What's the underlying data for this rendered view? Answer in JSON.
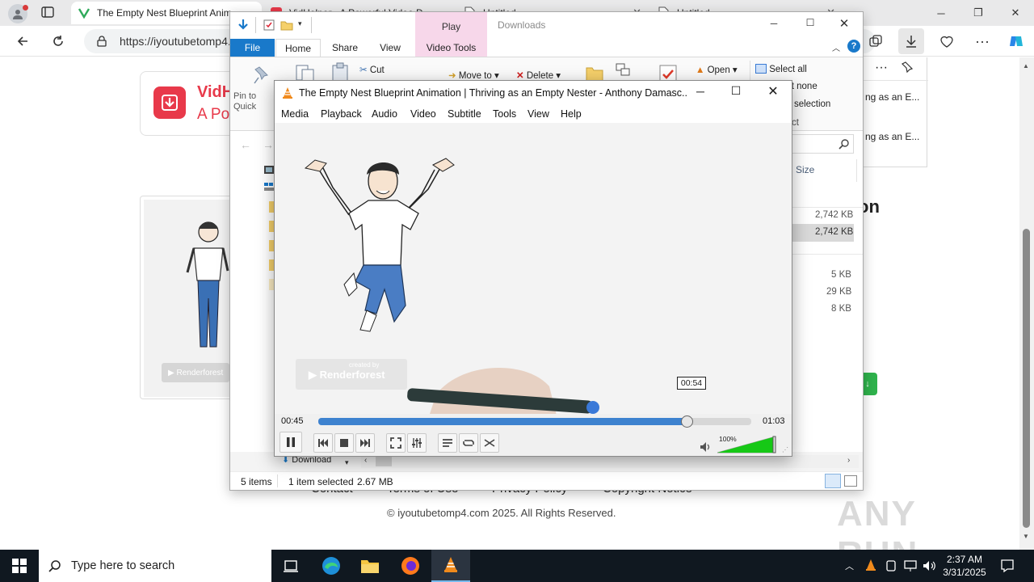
{
  "colors": {
    "vlc_accent": "#4a90d9",
    "explorer_blue": "#1979ca",
    "play_tab": "#f7d7ea",
    "vidhelper_red": "#e8394a",
    "taskbar": "#101820",
    "volume_green": "#16c816"
  },
  "browser": {
    "tabs": [
      {
        "title": "The Empty Nest Blueprint Anim",
        "icon": "vidhelper-icon",
        "active": true
      },
      {
        "title": "VidHelper - A Powerful Video D",
        "icon": "vidhelper-icon"
      },
      {
        "title": "Untitled",
        "icon": "document-icon"
      },
      {
        "title": "Untitled",
        "icon": "document-icon"
      }
    ],
    "url": "https://iyoutubetomp4."
  },
  "webpage": {
    "logo_title": "VidH",
    "logo_subtitle": "A Po",
    "heading_fragment": "on",
    "footer_links": [
      "Contact",
      "Terms of Use",
      "Privacy Policy",
      "Copyright Notice"
    ],
    "copyright": "© iyoutubetomp4.com 2025. All Rights Reserved.",
    "downloads_panel": {
      "items": [
        "ng as an E...",
        "ng as an E..."
      ]
    },
    "thumb_watermark": "Renderforest"
  },
  "explorer": {
    "title": "Downloads",
    "context_tab": "Play",
    "tabs": [
      "File",
      "Home",
      "Share",
      "View",
      "Video Tools"
    ],
    "ribbon": {
      "pin_label": "Pin to Quick access",
      "cut": "Cut",
      "move_to": "Move to",
      "delete": "Delete",
      "open": "Open",
      "select_all": "Select all",
      "select_none": "Select none",
      "invert_selection": "Invert selection",
      "select_label": "Select"
    },
    "column_size": "Size",
    "sizes": [
      "2,742 KB",
      "2,742 KB",
      "5 KB",
      "29 KB",
      "8 KB"
    ],
    "nav_download": "Download",
    "status": {
      "items": "5 items",
      "selected": "1 item selected",
      "size": "2.67 MB"
    }
  },
  "vlc": {
    "title": "The Empty Nest Blueprint Animation  |  Thriving as an Empty Nester - Anthony Damasc...",
    "menu": [
      "Media",
      "Playback",
      "Audio",
      "Video",
      "Subtitle",
      "Tools",
      "View",
      "Help"
    ],
    "elapsed": "00:45",
    "total": "01:03",
    "hover_time": "00:54",
    "progress": 0.85,
    "volume_label": "100%",
    "volume": 1.0,
    "video_watermark_small": "created by",
    "video_watermark": "Renderforest"
  },
  "taskbar": {
    "search_placeholder": "Type here to search",
    "time": "2:37 AM",
    "date": "3/31/2025"
  },
  "watermark": "ANY RUN"
}
